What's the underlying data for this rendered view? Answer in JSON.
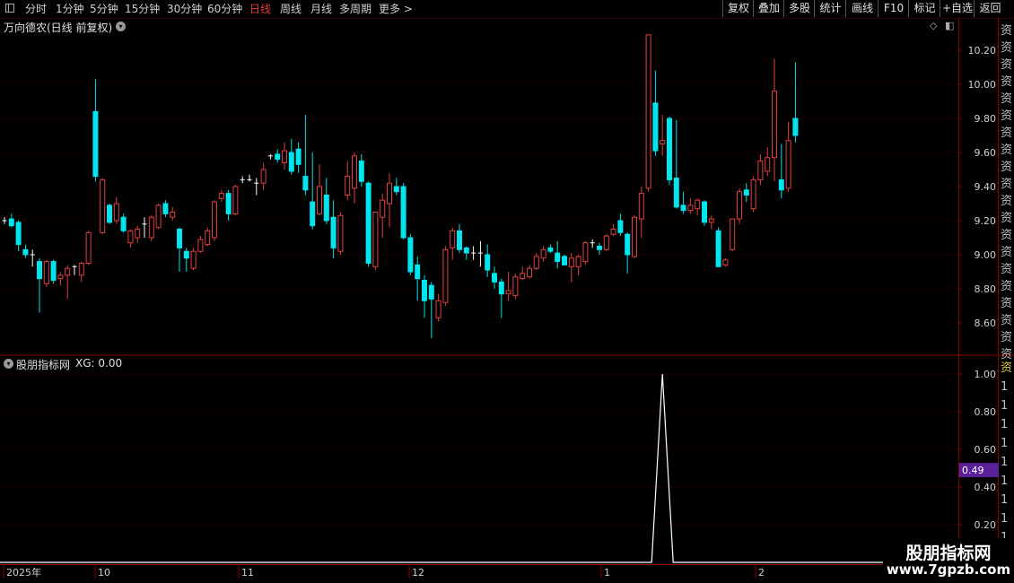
{
  "toolbar": {
    "periods": [
      "分时",
      "1分钟",
      "5分钟",
      "15分钟",
      "30分钟",
      "60分钟",
      "日线",
      "周线",
      "月线",
      "多周期",
      "更多 >"
    ],
    "active_period": "日线",
    "right_buttons": [
      "复权",
      "叠加",
      "多股",
      "统计",
      "画线",
      "F10",
      "标记",
      "+自选",
      "返回"
    ]
  },
  "main_chart": {
    "title": "万向德农(日线 前复权)",
    "y_ticks": [
      "10.20",
      "10.00",
      "9.80",
      "9.60",
      "9.40",
      "9.20",
      "9.00",
      "8.80",
      "8.60"
    ]
  },
  "indicator": {
    "title": "股朋指标网",
    "xg_label": "XG: 0.00",
    "y_ticks": [
      "1.00",
      "0.80",
      "0.60",
      "0.40",
      "0.20"
    ],
    "cursor_value": "0.49"
  },
  "date_axis": [
    "2025年",
    "10",
    "11",
    "12",
    "1",
    "2"
  ],
  "right_strip": {
    "top_chars": [
      "资",
      "资",
      "资",
      "资",
      "资",
      "资",
      "资",
      "资",
      "资",
      "资",
      "资",
      "资",
      "资",
      "资",
      "资",
      "资",
      "资",
      "资",
      "资",
      "资"
    ],
    "bottom_chars": [
      "资",
      "1",
      "1",
      "1",
      "1",
      "1",
      "1",
      "1",
      "1",
      "1"
    ]
  },
  "watermark": {
    "line1": "股朋指标网",
    "line2": "www.7gpzb.com"
  },
  "colors": {
    "up": "#e04040",
    "down": "#00e5ee",
    "doji": "#ffffff",
    "grid": "#5a0000",
    "line": "#ffffff",
    "cursor_bg": "#5a1f99"
  },
  "chart_data": {
    "type": "candlestick",
    "ylim": [
      8.45,
      10.32
    ],
    "x_labels": [
      "2025年",
      "10",
      "11",
      "12",
      "1",
      "2"
    ],
    "candles": [
      {
        "o": 9.2,
        "h": 9.22,
        "l": 9.18,
        "c": 9.19
      },
      {
        "o": 9.21,
        "h": 9.24,
        "l": 9.16,
        "c": 9.17
      },
      {
        "o": 9.19,
        "h": 9.2,
        "l": 9.02,
        "c": 9.06
      },
      {
        "o": 9.03,
        "h": 9.06,
        "l": 8.98,
        "c": 9.0
      },
      {
        "o": 9.0,
        "h": 9.03,
        "l": 8.93,
        "c": 9.0
      },
      {
        "o": 8.96,
        "h": 8.98,
        "l": 8.66,
        "c": 8.86
      },
      {
        "o": 8.83,
        "h": 8.97,
        "l": 8.81,
        "c": 8.96
      },
      {
        "o": 8.96,
        "h": 8.97,
        "l": 8.83,
        "c": 8.85
      },
      {
        "o": 8.86,
        "h": 8.9,
        "l": 8.82,
        "c": 8.88
      },
      {
        "o": 8.88,
        "h": 8.94,
        "l": 8.74,
        "c": 8.92
      },
      {
        "o": 8.92,
        "h": 8.94,
        "l": 8.88,
        "c": 8.93
      },
      {
        "o": 8.88,
        "h": 8.96,
        "l": 8.84,
        "c": 8.95
      },
      {
        "o": 8.95,
        "h": 9.14,
        "l": 8.94,
        "c": 9.13
      },
      {
        "o": 9.84,
        "h": 10.03,
        "l": 9.43,
        "c": 9.46
      },
      {
        "o": 9.13,
        "h": 9.45,
        "l": 9.12,
        "c": 9.44
      },
      {
        "o": 9.29,
        "h": 9.3,
        "l": 9.18,
        "c": 9.19
      },
      {
        "o": 9.2,
        "h": 9.34,
        "l": 9.18,
        "c": 9.3
      },
      {
        "o": 9.22,
        "h": 9.24,
        "l": 9.13,
        "c": 9.14
      },
      {
        "o": 9.07,
        "h": 9.15,
        "l": 9.04,
        "c": 9.14
      },
      {
        "o": 9.1,
        "h": 9.17,
        "l": 9.07,
        "c": 9.15
      },
      {
        "o": 9.18,
        "h": 9.22,
        "l": 9.1,
        "c": 9.18
      },
      {
        "o": 9.1,
        "h": 9.23,
        "l": 9.08,
        "c": 9.22
      },
      {
        "o": 9.16,
        "h": 9.3,
        "l": 9.15,
        "c": 9.29
      },
      {
        "o": 9.3,
        "h": 9.32,
        "l": 9.22,
        "c": 9.24
      },
      {
        "o": 9.22,
        "h": 9.28,
        "l": 9.2,
        "c": 9.25
      },
      {
        "o": 9.15,
        "h": 9.16,
        "l": 8.9,
        "c": 9.04
      },
      {
        "o": 9.02,
        "h": 9.04,
        "l": 8.9,
        "c": 8.98
      },
      {
        "o": 8.92,
        "h": 9.04,
        "l": 8.91,
        "c": 9.02
      },
      {
        "o": 9.02,
        "h": 9.11,
        "l": 9.01,
        "c": 9.09
      },
      {
        "o": 9.06,
        "h": 9.16,
        "l": 9.05,
        "c": 9.14
      },
      {
        "o": 9.1,
        "h": 9.32,
        "l": 9.08,
        "c": 9.31
      },
      {
        "o": 9.33,
        "h": 9.38,
        "l": 9.31,
        "c": 9.36
      },
      {
        "o": 9.36,
        "h": 9.38,
        "l": 9.2,
        "c": 9.24
      },
      {
        "o": 9.24,
        "h": 9.41,
        "l": 9.23,
        "c": 9.4
      },
      {
        "o": 9.43,
        "h": 9.46,
        "l": 9.42,
        "c": 9.44
      },
      {
        "o": 9.44,
        "h": 9.47,
        "l": 9.43,
        "c": 9.44
      },
      {
        "o": 9.41,
        "h": 9.45,
        "l": 9.35,
        "c": 9.42
      },
      {
        "o": 9.42,
        "h": 9.54,
        "l": 9.38,
        "c": 9.5
      },
      {
        "o": 9.58,
        "h": 9.59,
        "l": 9.56,
        "c": 9.57
      },
      {
        "o": 9.59,
        "h": 9.62,
        "l": 9.54,
        "c": 9.56
      },
      {
        "o": 9.54,
        "h": 9.66,
        "l": 9.5,
        "c": 9.61
      },
      {
        "o": 9.6,
        "h": 9.68,
        "l": 9.47,
        "c": 9.49
      },
      {
        "o": 9.62,
        "h": 9.66,
        "l": 9.48,
        "c": 9.53
      },
      {
        "o": 9.46,
        "h": 9.82,
        "l": 9.35,
        "c": 9.38
      },
      {
        "o": 9.31,
        "h": 9.6,
        "l": 9.15,
        "c": 9.17
      },
      {
        "o": 9.24,
        "h": 9.53,
        "l": 9.23,
        "c": 9.4
      },
      {
        "o": 9.35,
        "h": 9.45,
        "l": 9.18,
        "c": 9.2
      },
      {
        "o": 9.22,
        "h": 9.32,
        "l": 8.98,
        "c": 9.04
      },
      {
        "o": 9.02,
        "h": 9.25,
        "l": 9.0,
        "c": 9.23
      },
      {
        "o": 9.35,
        "h": 9.55,
        "l": 9.32,
        "c": 9.46
      },
      {
        "o": 9.39,
        "h": 9.6,
        "l": 9.3,
        "c": 9.58
      },
      {
        "o": 9.55,
        "h": 9.59,
        "l": 9.4,
        "c": 9.43
      },
      {
        "o": 9.42,
        "h": 9.43,
        "l": 8.93,
        "c": 8.95
      },
      {
        "o": 8.93,
        "h": 9.25,
        "l": 8.91,
        "c": 9.25
      },
      {
        "o": 9.22,
        "h": 9.36,
        "l": 9.1,
        "c": 9.32
      },
      {
        "o": 9.3,
        "h": 9.48,
        "l": 9.16,
        "c": 9.42
      },
      {
        "o": 9.4,
        "h": 9.45,
        "l": 9.35,
        "c": 9.37
      },
      {
        "o": 9.4,
        "h": 9.42,
        "l": 9.09,
        "c": 9.1
      },
      {
        "o": 9.1,
        "h": 9.12,
        "l": 8.88,
        "c": 8.9
      },
      {
        "o": 8.94,
        "h": 8.99,
        "l": 8.73,
        "c": 8.86
      },
      {
        "o": 8.85,
        "h": 8.88,
        "l": 8.63,
        "c": 8.73
      },
      {
        "o": 8.82,
        "h": 8.84,
        "l": 8.51,
        "c": 8.74
      },
      {
        "o": 8.63,
        "h": 8.77,
        "l": 8.61,
        "c": 8.73
      },
      {
        "o": 8.72,
        "h": 9.05,
        "l": 8.7,
        "c": 9.03
      },
      {
        "o": 9.04,
        "h": 9.16,
        "l": 8.97,
        "c": 9.14
      },
      {
        "o": 9.14,
        "h": 9.18,
        "l": 9.01,
        "c": 9.03
      },
      {
        "o": 9.04,
        "h": 9.05,
        "l": 8.97,
        "c": 9.01
      },
      {
        "o": 9.01,
        "h": 9.05,
        "l": 8.97,
        "c": 9.01
      },
      {
        "o": 9.01,
        "h": 9.08,
        "l": 8.93,
        "c": 9.01
      },
      {
        "o": 9.0,
        "h": 9.06,
        "l": 8.87,
        "c": 8.91
      },
      {
        "o": 8.89,
        "h": 8.93,
        "l": 8.8,
        "c": 8.84
      },
      {
        "o": 8.84,
        "h": 8.86,
        "l": 8.63,
        "c": 8.77
      },
      {
        "o": 8.77,
        "h": 8.9,
        "l": 8.73,
        "c": 8.79
      },
      {
        "o": 8.76,
        "h": 8.89,
        "l": 8.74,
        "c": 8.87
      },
      {
        "o": 8.86,
        "h": 8.93,
        "l": 8.85,
        "c": 8.89
      },
      {
        "o": 8.87,
        "h": 8.94,
        "l": 8.86,
        "c": 8.92
      },
      {
        "o": 8.92,
        "h": 9.01,
        "l": 8.91,
        "c": 8.99
      },
      {
        "o": 8.98,
        "h": 9.05,
        "l": 8.96,
        "c": 9.03
      },
      {
        "o": 9.04,
        "h": 9.06,
        "l": 9.01,
        "c": 9.02
      },
      {
        "o": 9.01,
        "h": 9.08,
        "l": 8.92,
        "c": 8.96
      },
      {
        "o": 8.99,
        "h": 9.0,
        "l": 8.94,
        "c": 8.94
      },
      {
        "o": 8.93,
        "h": 9.01,
        "l": 8.84,
        "c": 8.98
      },
      {
        "o": 8.93,
        "h": 9.0,
        "l": 8.88,
        "c": 8.99
      },
      {
        "o": 8.96,
        "h": 9.08,
        "l": 8.94,
        "c": 9.07
      },
      {
        "o": 9.06,
        "h": 9.09,
        "l": 9.04,
        "c": 9.07
      },
      {
        "o": 9.05,
        "h": 9.07,
        "l": 9.0,
        "c": 9.03
      },
      {
        "o": 9.03,
        "h": 9.12,
        "l": 9.02,
        "c": 9.11
      },
      {
        "o": 9.12,
        "h": 9.18,
        "l": 9.11,
        "c": 9.15
      },
      {
        "o": 9.2,
        "h": 9.24,
        "l": 9.11,
        "c": 9.13
      },
      {
        "o": 9.12,
        "h": 9.13,
        "l": 8.89,
        "c": 9.0
      },
      {
        "o": 8.99,
        "h": 9.23,
        "l": 8.98,
        "c": 9.22
      },
      {
        "o": 9.21,
        "h": 9.4,
        "l": 9.1,
        "c": 9.36
      },
      {
        "o": 9.39,
        "h": 10.29,
        "l": 9.37,
        "c": 10.29
      },
      {
        "o": 9.89,
        "h": 10.08,
        "l": 9.58,
        "c": 9.61
      },
      {
        "o": 9.65,
        "h": 9.82,
        "l": 9.58,
        "c": 9.67
      },
      {
        "o": 9.8,
        "h": 9.81,
        "l": 9.41,
        "c": 9.44
      },
      {
        "o": 9.45,
        "h": 9.79,
        "l": 9.27,
        "c": 9.28
      },
      {
        "o": 9.29,
        "h": 9.37,
        "l": 9.24,
        "c": 9.26
      },
      {
        "o": 9.26,
        "h": 9.33,
        "l": 9.24,
        "c": 9.29
      },
      {
        "o": 9.27,
        "h": 9.33,
        "l": 9.23,
        "c": 9.32
      },
      {
        "o": 9.31,
        "h": 9.32,
        "l": 9.17,
        "c": 9.19
      },
      {
        "o": 9.19,
        "h": 9.23,
        "l": 9.15,
        "c": 9.21
      },
      {
        "o": 9.14,
        "h": 9.16,
        "l": 8.93,
        "c": 8.93
      },
      {
        "o": 8.94,
        "h": 8.98,
        "l": 8.93,
        "c": 8.97
      },
      {
        "o": 9.03,
        "h": 9.21,
        "l": 9.02,
        "c": 9.21
      },
      {
        "o": 9.21,
        "h": 9.39,
        "l": 9.18,
        "c": 9.37
      },
      {
        "o": 9.38,
        "h": 9.42,
        "l": 9.31,
        "c": 9.35
      },
      {
        "o": 9.27,
        "h": 9.46,
        "l": 9.25,
        "c": 9.44
      },
      {
        "o": 9.44,
        "h": 9.59,
        "l": 9.41,
        "c": 9.55
      },
      {
        "o": 9.49,
        "h": 9.63,
        "l": 9.46,
        "c": 9.57
      },
      {
        "o": 9.57,
        "h": 10.15,
        "l": 9.43,
        "c": 9.96
      },
      {
        "o": 9.44,
        "h": 9.65,
        "l": 9.33,
        "c": 9.38
      },
      {
        "o": 9.39,
        "h": 9.78,
        "l": 9.37,
        "c": 9.67
      },
      {
        "o": 9.8,
        "h": 10.13,
        "l": 9.66,
        "c": 9.7
      }
    ],
    "indicator_series": {
      "name": "XG",
      "ylim": [
        0,
        1.0
      ],
      "values_spike_index": 94,
      "spike_value": 1.0
    }
  }
}
